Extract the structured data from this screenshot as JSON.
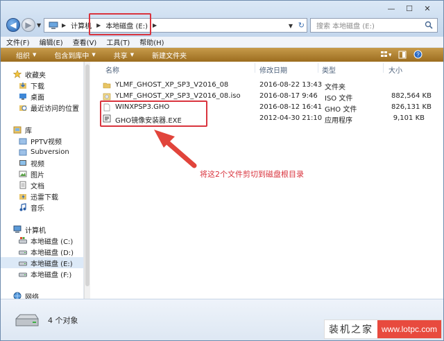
{
  "window": {
    "controls": {
      "minimize": "—",
      "maximize": "☐",
      "close": "✕"
    }
  },
  "address": {
    "crumbs": [
      "计算机",
      "本地磁盘 (E:)"
    ],
    "search_placeholder": "搜索 本地磁盘 (E:)"
  },
  "menu": [
    "文件(F)",
    "编辑(E)",
    "查看(V)",
    "工具(T)",
    "帮助(H)"
  ],
  "toolbar": {
    "organize": "组织",
    "include_library": "包含到库中",
    "share": "共享",
    "new_folder": "新建文件夹"
  },
  "sidebar": {
    "favorites": {
      "label": "收藏夹",
      "items": [
        "下载",
        "桌面",
        "最近访问的位置"
      ]
    },
    "libraries": {
      "label": "库",
      "items": [
        "PPTV视频",
        "Subversion",
        "视频",
        "图片",
        "文档",
        "迅雷下载",
        "音乐"
      ]
    },
    "computer": {
      "label": "计算机",
      "items": [
        "本地磁盘 (C:)",
        "本地磁盘 (D:)",
        "本地磁盘 (E:)",
        "本地磁盘 (F:)"
      ],
      "selected": "本地磁盘 (E:)"
    },
    "network": {
      "label": "网络"
    }
  },
  "columns": {
    "name": "名称",
    "modified": "修改日期",
    "type": "类型",
    "size": "大小"
  },
  "files": [
    {
      "name": "YLMF_GHOST_XP_SP3_V2016_08",
      "modified": "2016-08-22 13:43",
      "type": "文件夹",
      "size": "",
      "icon": "folder-icon"
    },
    {
      "name": "YLMF_GHOST_XP_SP3_V2016_08.iso",
      "modified": "2016-08-17 9:46",
      "type": "ISO 文件",
      "size": "882,564 KB",
      "icon": "iso-file-icon"
    },
    {
      "name": "WINXPSP3.GHO",
      "modified": "2016-08-12 16:41",
      "type": "GHO 文件",
      "size": "826,131 KB",
      "icon": "blank-file-icon"
    },
    {
      "name": "GHO镜像安装器.EXE",
      "modified": "2012-04-30 21:10",
      "type": "应用程序",
      "size": "9,101 KB",
      "icon": "exe-file-icon"
    }
  ],
  "annotation": "将这2个文件剪切到磁盘根目录",
  "status": {
    "count": "4 个对象"
  },
  "watermark": {
    "cn": "装机之家",
    "url": "www.lotpc.com"
  },
  "colors": {
    "toolbar": "#b2843a",
    "highlight": "#d9333d",
    "selection": "#dce9f7"
  }
}
